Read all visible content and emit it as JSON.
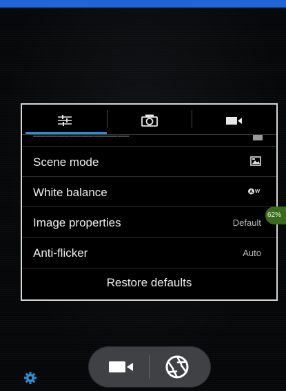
{
  "statusbar": {
    "color": "#1f64d8"
  },
  "settings_panel": {
    "tabs": [
      {
        "name": "general-settings",
        "icon": "sliders-icon",
        "selected": true
      },
      {
        "name": "photo-settings",
        "icon": "camera-icon",
        "selected": false
      },
      {
        "name": "video-settings",
        "icon": "video-camera-icon",
        "selected": false
      }
    ],
    "accent_color": "#2d8fd6",
    "rows": [
      {
        "label": "Scene mode",
        "value_icon": "scene-mode-icon"
      },
      {
        "label": "White balance",
        "value_icon": "auto-white-balance-icon"
      },
      {
        "label": "Image properties",
        "value": "Default"
      },
      {
        "label": "Anti-flicker",
        "value": "Auto"
      }
    ],
    "restore_label": "Restore defaults"
  },
  "battery": {
    "label": "62%",
    "color": "#3a6b1d"
  },
  "bottom_bar": {
    "settings_icon": "gear-icon",
    "settings_icon_color": "#2d8fd6",
    "video_icon": "video-camera-icon",
    "shutter_icon": "shutter-aperture-icon"
  }
}
